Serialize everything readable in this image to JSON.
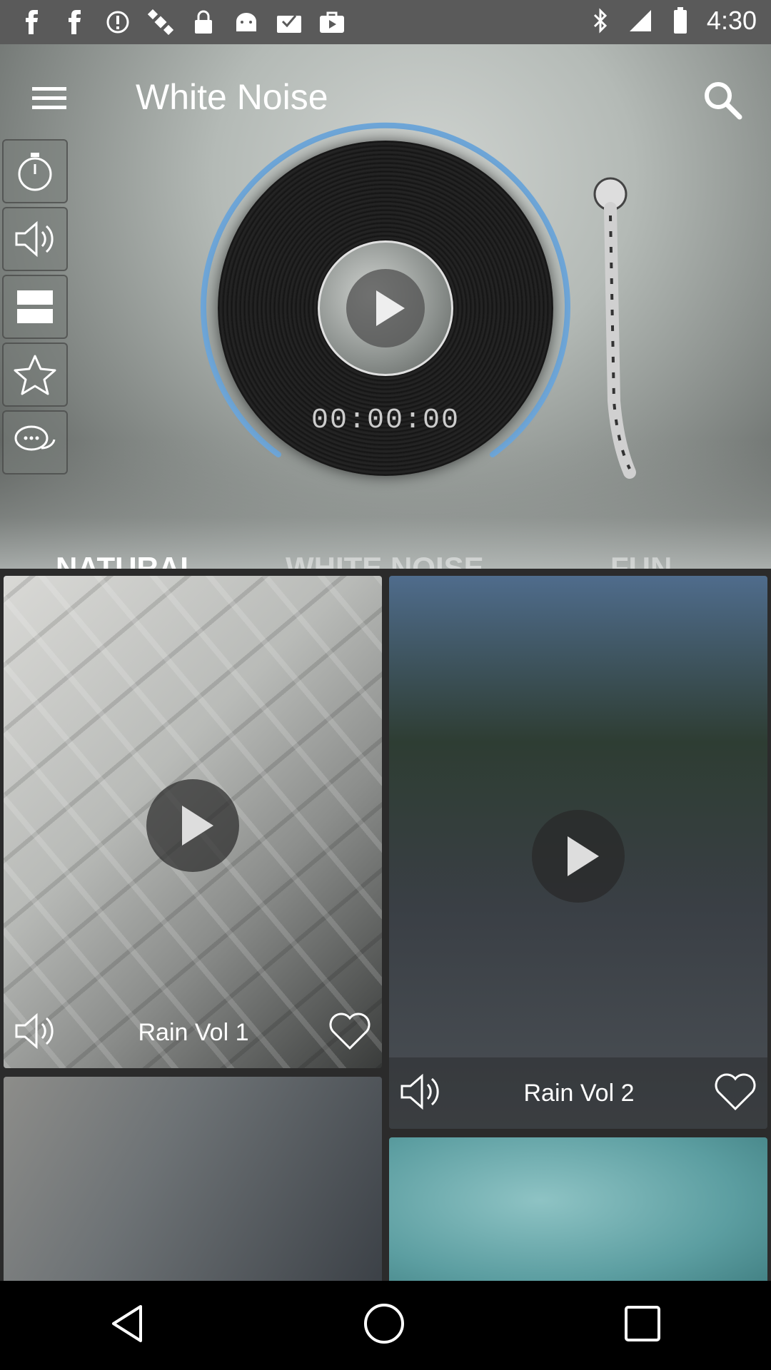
{
  "status_bar": {
    "time": "4:30",
    "left_icons": [
      "facebook-icon",
      "facebook-icon",
      "alert-icon",
      "satellite-icon",
      "lock-icon",
      "android-icon",
      "inbox-icon",
      "bag-icon"
    ],
    "right_icons": [
      "bluetooth-icon",
      "signal-icon",
      "battery-icon"
    ]
  },
  "header": {
    "title": "White Noise",
    "menu_icon": "menu-icon",
    "search_icon": "search-icon"
  },
  "side_tools": [
    {
      "name": "timer-icon"
    },
    {
      "name": "volume-icon"
    },
    {
      "name": "layout-icon"
    },
    {
      "name": "star-icon"
    },
    {
      "name": "chat-icon"
    }
  ],
  "player": {
    "timer": "00:00:00",
    "arc_color": "#6ea6d8"
  },
  "tabs": {
    "items": [
      {
        "label": "NATURAL",
        "active": true
      },
      {
        "label": "WHITE NOISE",
        "active": false
      },
      {
        "label": "FUN",
        "active": false
      }
    ],
    "indicator_color": "#4fc3f7"
  },
  "tracks": [
    {
      "name": "Rain Vol 1"
    },
    {
      "name": "Rain Vol 2"
    }
  ],
  "navbar": [
    "back-icon",
    "home-icon",
    "recents-icon"
  ]
}
